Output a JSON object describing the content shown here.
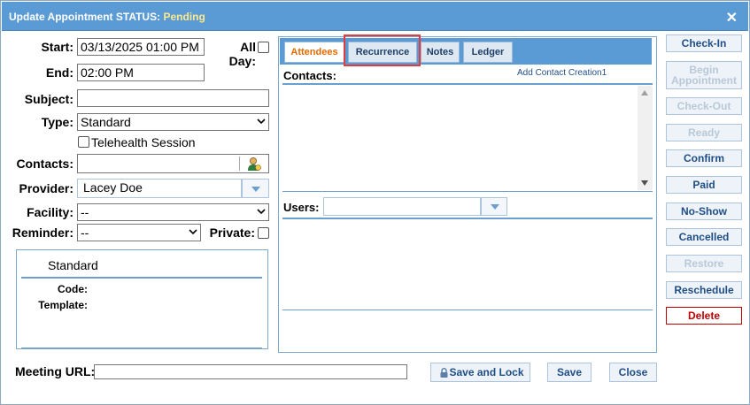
{
  "title": {
    "prefix": "Update Appointment STATUS:",
    "status": "Pending"
  },
  "form": {
    "start_label": "Start:",
    "start_value": "03/13/2025 01:00 PM",
    "allday_label": "All Day:",
    "end_label": "End:",
    "end_value": "02:00 PM",
    "subject_label": "Subject:",
    "subject_value": "",
    "type_label": "Type:",
    "type_value": "Standard",
    "telehealth_label": "Telehealth Session",
    "contacts_label": "Contacts:",
    "provider_label": "Provider:",
    "provider_value": "Lacey Doe",
    "facility_label": "Facility:",
    "facility_value": "--",
    "reminder_label": "Reminder:",
    "reminder_value": "--",
    "private_label": "Private:"
  },
  "type_panel": {
    "title": "Standard",
    "code_label": "Code:",
    "template_label": "Template:"
  },
  "tabs": [
    {
      "label": "Attendees",
      "active": true
    },
    {
      "label": "Recurrence",
      "active": false
    },
    {
      "label": "Notes",
      "active": false
    },
    {
      "label": "Ledger",
      "active": false
    }
  ],
  "attendees": {
    "contacts_label": "Contacts:",
    "add_contact_link": "Add Contact Creation1",
    "users_label": "Users:"
  },
  "actions": [
    {
      "label": "Check-In",
      "state": "enabled"
    },
    {
      "label": "Begin Appointment",
      "state": "disabled"
    },
    {
      "label": "Check-Out",
      "state": "disabled"
    },
    {
      "label": "Ready",
      "state": "disabled"
    },
    {
      "label": "Confirm",
      "state": "enabled"
    },
    {
      "label": "Paid",
      "state": "enabled"
    },
    {
      "label": "No-Show",
      "state": "enabled"
    },
    {
      "label": "Cancelled",
      "state": "enabled"
    },
    {
      "label": "Restore",
      "state": "disabled"
    },
    {
      "label": "Reschedule",
      "state": "enabled"
    },
    {
      "label": "Delete",
      "state": "danger"
    }
  ],
  "footer": {
    "meeting_url_label": "Meeting URL:",
    "meeting_url_value": "",
    "save_lock_label": "Save and Lock",
    "save_label": "Save",
    "close_label": "Close"
  },
  "colors": {
    "titlebar": "#5b9bd5",
    "status": "#ffe88a",
    "active_tab": "#e06a00",
    "delete": "#c00000",
    "highlight": "#e23b3b"
  }
}
